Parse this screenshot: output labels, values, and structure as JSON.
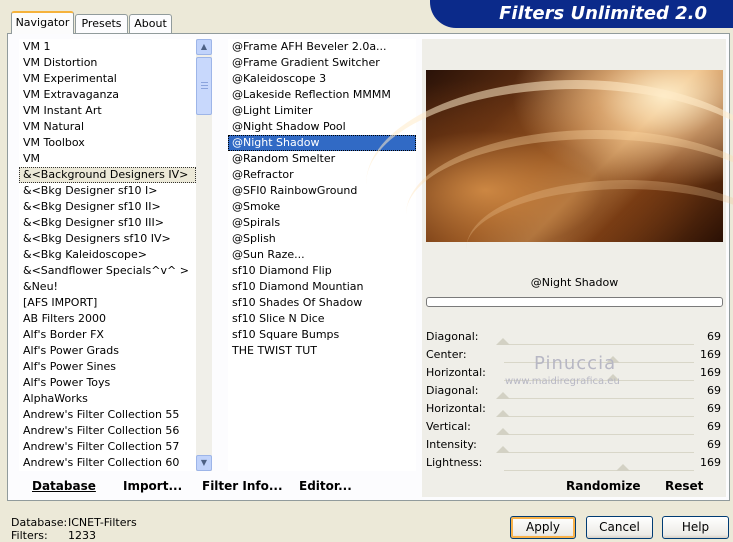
{
  "app": {
    "title": "Filters Unlimited 2.0"
  },
  "tabs": [
    {
      "label": "Navigator",
      "active": true
    },
    {
      "label": "Presets",
      "active": false
    },
    {
      "label": "About",
      "active": false
    }
  ],
  "categories": [
    "VM 1",
    "VM Distortion",
    "VM Experimental",
    "VM Extravaganza",
    "VM Instant Art",
    "VM Natural",
    "VM Toolbox",
    "VM",
    "&<Background Designers IV>",
    "&<Bkg Designer sf10 I>",
    "&<Bkg Designer sf10 II>",
    "&<Bkg Designer sf10 III>",
    "&<Bkg Designers sf10 IV>",
    "&<Bkg Kaleidoscope>",
    "&<Sandflower Specials^v^ >",
    "&Neu!",
    "[AFS IMPORT]",
    "AB Filters 2000",
    "Alf's Border FX",
    "Alf's Power Grads",
    "Alf's Power Sines",
    "Alf's Power Toys",
    "AlphaWorks",
    "Andrew's Filter Collection 55",
    "Andrew's Filter Collection 56",
    "Andrew's Filter Collection 57",
    "Andrew's Filter Collection 60"
  ],
  "selected_category": "&<Background Designers IV>",
  "filters": [
    "@Frame AFH Beveler 2.0a...",
    "@Frame Gradient Switcher",
    "@Kaleidoscope 3",
    "@Lakeside Reflection MMMM",
    "@Light Limiter",
    "@Night Shadow Pool",
    "@Night Shadow",
    "@Random Smelter",
    "@Refractor",
    "@SFI0 RainbowGround",
    "@Smoke",
    "@Spirals",
    "@Splish",
    "@Sun Raze...",
    "sf10 Diamond Flip",
    "sf10 Diamond Mountian",
    "sf10 Shades Of Shadow",
    "sf10 Slice N Dice",
    "sf10 Square Bumps",
    "THE TWIST TUT"
  ],
  "selected_filter": "@Night Shadow",
  "left_buttons": [
    "Database",
    "Import...",
    "Filter Info...",
    "Editor..."
  ],
  "filter_name": "@Night Shadow",
  "progress": 0,
  "params": [
    {
      "label": "Diagonal:",
      "value": "69"
    },
    {
      "label": "Center:",
      "value": "169"
    },
    {
      "label": "Horizontal:",
      "value": "169"
    },
    {
      "label": "Diagonal:",
      "value": "69"
    },
    {
      "label": "Horizontal:",
      "value": "69"
    },
    {
      "label": "Vertical:",
      "value": "69"
    },
    {
      "label": "Intensity:",
      "value": "69"
    },
    {
      "label": "Lightness:",
      "value": "169"
    }
  ],
  "right_buttons": {
    "randomize": "Randomize",
    "reset": "Reset"
  },
  "watermark": {
    "name": "Pinuccia",
    "site": "www.maidiregrafica.eu"
  },
  "status": {
    "database_label": "Database:",
    "database_value": "ICNET-Filters",
    "filters_label": "Filters:",
    "filters_value": "1233"
  },
  "dialog_buttons": {
    "apply": "Apply",
    "cancel": "Cancel",
    "help": "Help"
  }
}
